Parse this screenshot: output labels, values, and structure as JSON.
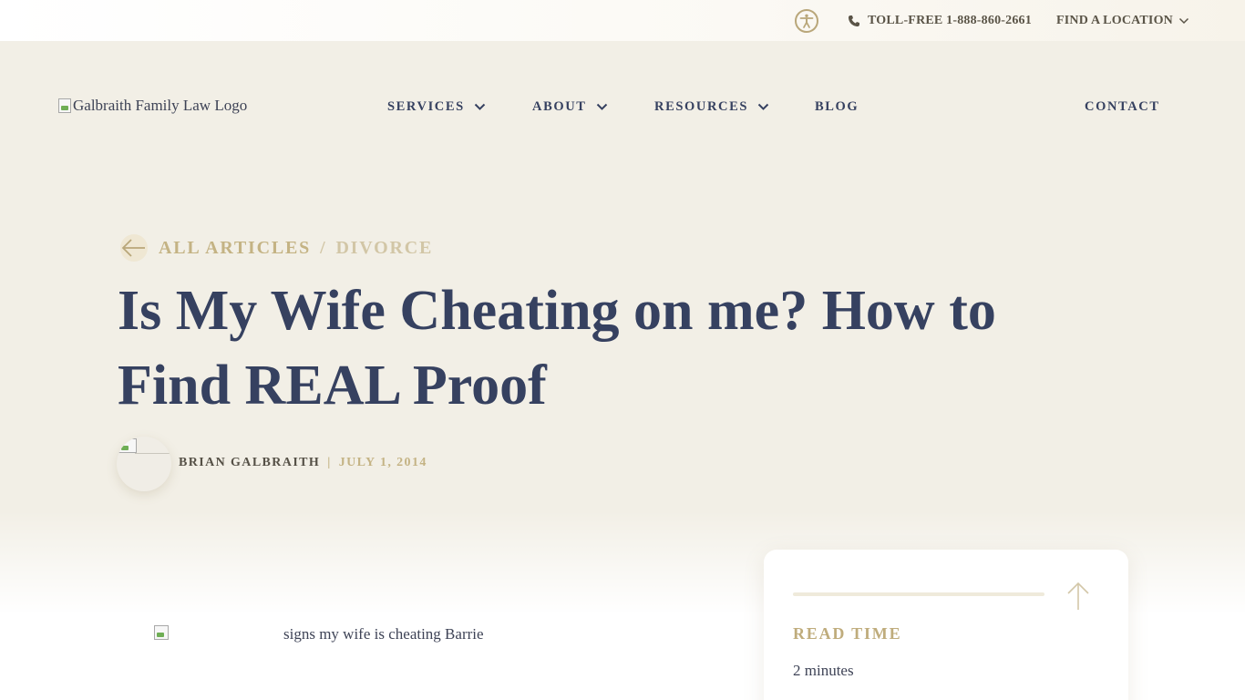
{
  "topbar": {
    "phone_label": "TOLL-FREE 1-888-860-2661",
    "location_label": "FIND A LOCATION"
  },
  "header": {
    "logo_alt": "Galbraith Family Law Logo",
    "nav": {
      "services": "SERVICES",
      "about": "ABOUT",
      "resources": "RESOURCES",
      "blog": "BLOG",
      "contact": "CONTACT"
    }
  },
  "article": {
    "breadcrumb": {
      "all": "ALL ARTICLES",
      "separator": "/",
      "category": "DIVORCE"
    },
    "title": "Is My Wife Cheating on me? How to Find REAL Proof",
    "author": "BRIAN GALBRAITH",
    "date_separator": "|",
    "date": "JULY 1, 2014",
    "image_alt": "signs my wife is cheating Barrie"
  },
  "sidebar": {
    "read_time_label": "READ TIME",
    "read_time_value": "2 minutes",
    "reading_progress": 0
  },
  "colors": {
    "page_bg": "#f2efe6",
    "navy": "#364160",
    "gold": "#c4b384"
  },
  "icons": [
    "accessibility-icon",
    "phone-icon",
    "chevron-down-icon",
    "arrow-left-icon",
    "arrow-up-icon"
  ]
}
